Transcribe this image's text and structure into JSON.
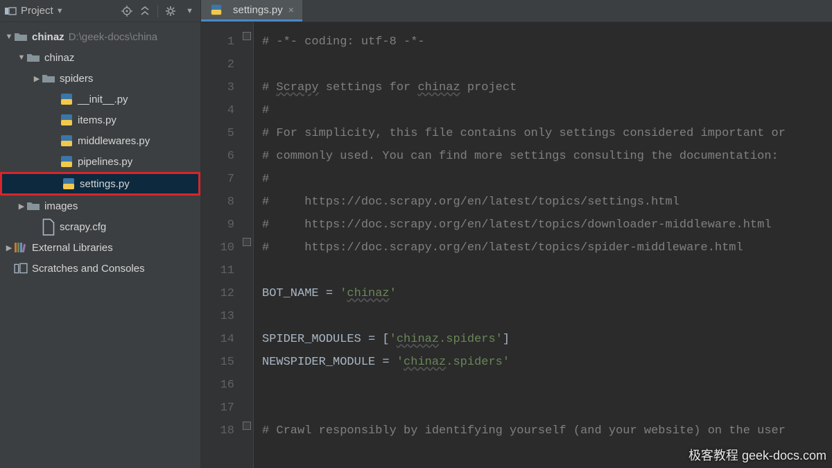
{
  "sidebar": {
    "title": "Project",
    "root": {
      "name": "chinaz",
      "path": "D:\\geek-docs\\china"
    },
    "nodes": {
      "pkg": "chinaz",
      "spiders": "spiders",
      "init": "__init__.py",
      "items": "items.py",
      "middlewares": "middlewares.py",
      "pipelines": "pipelines.py",
      "settings": "settings.py",
      "images": "images",
      "cfg": "scrapy.cfg",
      "extlib": "External Libraries",
      "scratch": "Scratches and Consoles"
    }
  },
  "tab": {
    "filename": "settings.py"
  },
  "code": {
    "lines": [
      {
        "n": 1,
        "t": "# -*- coding: utf-8 -*-",
        "cls": "c-comm"
      },
      {
        "n": 2,
        "t": "",
        "cls": ""
      },
      {
        "n": 3,
        "seg": [
          {
            "t": "# ",
            "c": "c-comm"
          },
          {
            "t": "Scrapy",
            "c": "c-comm c-und"
          },
          {
            "t": " settings for ",
            "c": "c-comm"
          },
          {
            "t": "chinaz",
            "c": "c-comm c-und"
          },
          {
            "t": " project",
            "c": "c-comm"
          }
        ]
      },
      {
        "n": 4,
        "t": "#",
        "cls": "c-comm"
      },
      {
        "n": 5,
        "t": "# For simplicity, this file contains only settings considered important or",
        "cls": "c-comm"
      },
      {
        "n": 6,
        "t": "# commonly used. You can find more settings consulting the documentation:",
        "cls": "c-comm"
      },
      {
        "n": 7,
        "t": "#",
        "cls": "c-comm"
      },
      {
        "n": 8,
        "t": "#     https://doc.scrapy.org/en/latest/topics/settings.html",
        "cls": "c-comm"
      },
      {
        "n": 9,
        "t": "#     https://doc.scrapy.org/en/latest/topics/downloader-middleware.html",
        "cls": "c-comm"
      },
      {
        "n": 10,
        "t": "#     https://doc.scrapy.org/en/latest/topics/spider-middleware.html",
        "cls": "c-comm"
      },
      {
        "n": 11,
        "t": "",
        "cls": ""
      },
      {
        "n": 12,
        "seg": [
          {
            "t": "BOT_NAME = ",
            "c": "c-ident"
          },
          {
            "t": "'",
            "c": "c-str"
          },
          {
            "t": "chinaz",
            "c": "c-str c-und"
          },
          {
            "t": "'",
            "c": "c-str"
          }
        ]
      },
      {
        "n": 13,
        "t": "",
        "cls": ""
      },
      {
        "n": 14,
        "seg": [
          {
            "t": "SPIDER_MODULES = [",
            "c": "c-ident"
          },
          {
            "t": "'",
            "c": "c-str"
          },
          {
            "t": "chinaz",
            "c": "c-str c-und"
          },
          {
            "t": ".spiders'",
            "c": "c-str"
          },
          {
            "t": "]",
            "c": "c-ident"
          }
        ]
      },
      {
        "n": 15,
        "seg": [
          {
            "t": "NEWSPIDER_MODULE = ",
            "c": "c-ident"
          },
          {
            "t": "'",
            "c": "c-str"
          },
          {
            "t": "chinaz",
            "c": "c-str c-und"
          },
          {
            "t": ".spiders'",
            "c": "c-str"
          }
        ]
      },
      {
        "n": 16,
        "t": "",
        "cls": ""
      },
      {
        "n": 17,
        "t": "",
        "cls": ""
      },
      {
        "n": 18,
        "t": "# Crawl responsibly by identifying yourself (and your website) on the user",
        "cls": "c-comm"
      }
    ]
  },
  "watermark": "极客教程 geek-docs.com"
}
